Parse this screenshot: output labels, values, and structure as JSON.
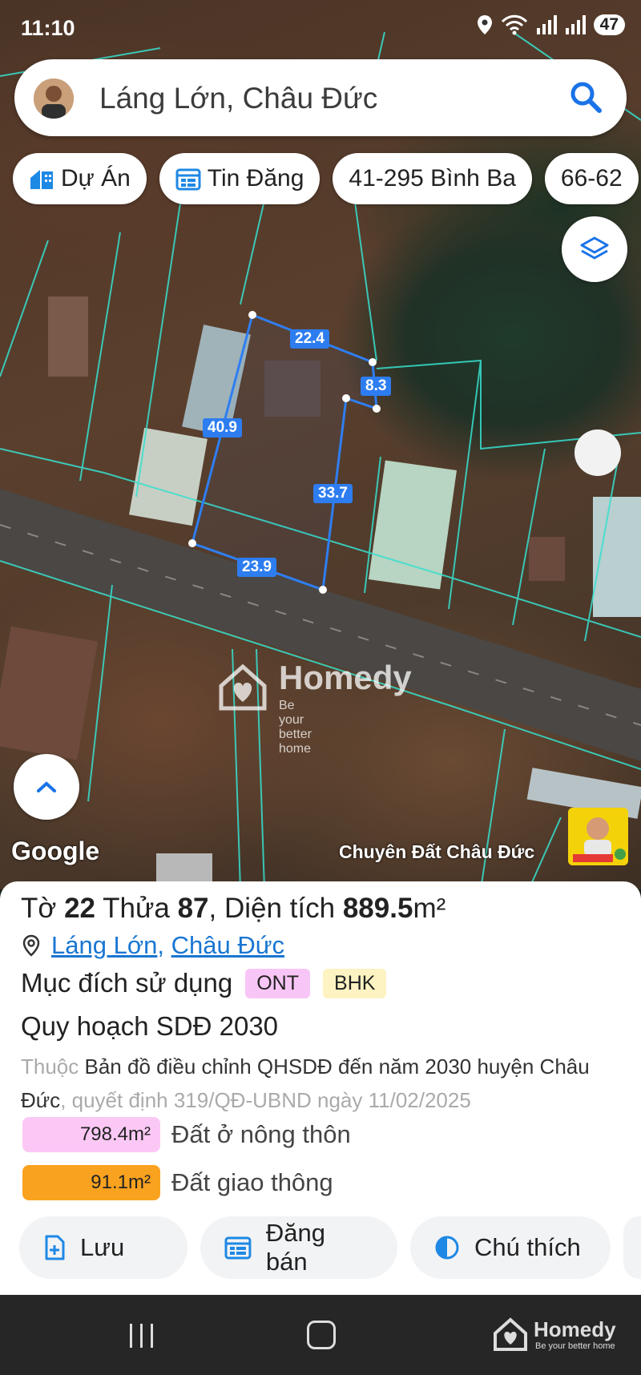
{
  "status_bar": {
    "time": "11:10",
    "battery": "47"
  },
  "search": {
    "query": "Láng Lớn, Châu Đức"
  },
  "chips": [
    {
      "label": "Dự Án",
      "icon": "building-icon"
    },
    {
      "label": "Tin Đăng",
      "icon": "listing-icon"
    },
    {
      "label": "41-295 Bình Ba",
      "icon": ""
    },
    {
      "label": "66-62",
      "icon": ""
    }
  ],
  "map": {
    "dimensions": [
      "22.4",
      "8.3",
      "40.9",
      "33.7",
      "23.9"
    ],
    "watermark_name": "Homedy",
    "watermark_slogan": "Be your better home",
    "google_label": "Google",
    "credit": "Chuyên Đất Châu Đức"
  },
  "parcel": {
    "to_label": "Tờ",
    "to_value": "22",
    "thua_label": "Thửa",
    "thua_value": "87",
    "area_label": ", Diện tích",
    "area_value": "889.5",
    "area_unit": "m²",
    "ward": "Láng Lớn",
    "separator": ",",
    "district": "Châu Đức",
    "purpose_label": "Mục đích sử dụng",
    "purpose_tags": [
      "ONT",
      "BHK"
    ],
    "plan_title": "Quy hoạch SDĐ 2030",
    "desc_prefix": "Thuộc",
    "desc_main": "Bản đồ điều chỉnh QHSDĐ đến năm 2030 huyện Châu Đức",
    "desc_suffix": ", quyết định 319/QĐ-UBND ngày 11/02/2025",
    "areas": [
      {
        "value": "798.4m²",
        "label": "Đất ở nông thôn",
        "color": "#fbc8f5"
      },
      {
        "value": "91.1m²",
        "label": "Đất giao thông",
        "color": "#f9a21f"
      }
    ]
  },
  "actions": {
    "save": "Lưu",
    "post": "Đăng bán",
    "legend": "Chú thích"
  },
  "nav": {
    "brand": "Homedy",
    "brand_slogan": "Be your better home"
  }
}
